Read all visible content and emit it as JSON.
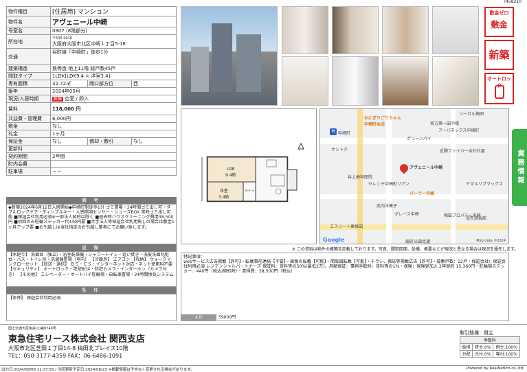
{
  "doc_id": "7458210",
  "spec": {
    "type_label": "物件種目",
    "type_value": "[住居用] マンション",
    "name_label": "物件名",
    "name_value": "アヴェニール中崎",
    "room_label": "号室名",
    "room_value": "0807 (8階部分)",
    "address_label": "所在地",
    "zip": "〒530-0016",
    "address": "大阪府大阪市北区中崎１丁目5-18",
    "transit_label": "交通",
    "transit": "谷町線「中崎町」徒歩1分",
    "structure_label": "建築構造",
    "structure": "鉄骨造 地上11階 総戸数45戸",
    "layout_label": "間取タイプ",
    "layout": "1LDK[LDK9.4 × 洋室3.4]",
    "area_label": "専有面積",
    "area": "32.72㎡",
    "direction_label": "開口部方位",
    "direction": "西",
    "built_label": "築年",
    "built": "2024年05月",
    "status_label": "現況/入居時期",
    "status_badge": "新築",
    "status": "空室 / 即入",
    "rent_label": "賃料",
    "rent": "118,000 円",
    "fee_label": "共益費・管理費",
    "fee": "6,000円",
    "deposit_label": "敷金",
    "deposit": "なし",
    "key_label": "礼金",
    "key": "1ヶ月",
    "guarantee_label": "保証金",
    "guarantee": "なし",
    "amort_label": "償却・敷引",
    "amort": "なし",
    "renew_label": "更新料",
    "renew": "",
    "period_label": "契約期間",
    "period": "2年間",
    "town_label": "町内会費",
    "town": "",
    "parking_label": "駐車場",
    "parking": "－－"
  },
  "remarks_head": "備 考",
  "remarks": "◆新築2024年6月12日入居開始◆中崎町駅徒歩1分 ゴミ置場・24時間ゴミ出し可・ダブルロックドア・ディンプルキー・人感照明センサー・シューズBOX 常時ゴミ出し可能 ■保証会社利用必須※一部法人契約は除く ■退去時ハウスクリーニング費用38,500円 ■初回のみ駐輪ステッカー代440円要 ■大手法人等保証会社利用無しの場合は敷金1ヶ月アップ要 ■お引越しは当社指定のお引越し業者にてお願い致します。",
  "facilities_head": "設 備",
  "facilities": "【水廻り】 洗面台（独立）・浴室乾燥機・シャワートイレ・追い焚き・洗髪洗面化粧台・バス・トイレ別・洗濯機置場（室内） 【冷暖房】 エアコン 【収納】 ウォークインクローゼット 【放送・通信】 ＢＳ・ＣＳ・インターネット対応・ネット使用料不要 【セキュリティ】 オートロック・宅配BOX・防犯カメラ・インターホン（カメラ付き） 【その他】 エレベーター・オートバイ駐輪場・自転車置場・24時間換気システム",
  "conditions_head": "条 件",
  "conditions": "【条件】 保証会社利用必須",
  "badges": {
    "zero": "敷金ゼロ",
    "zero_sub": "敷金",
    "new": "新築",
    "lock": "オートロック"
  },
  "side_tab": "業務情報",
  "floorplan": {
    "ldk": "LDK\n9.4帖",
    "western": "洋室\n3.4帖",
    "closet": "ｸﾛｰｾﾞｯﾄ"
  },
  "map": {
    "station": "中崎町",
    "shop1": "おにぎりごりちゃん 中崎町本店",
    "shop2": "パーラー中崎",
    "target": "アヴェニール中崎",
    "labels": [
      "リーガル梅田",
      "実方第一田中橋",
      "アーバネックス中崎町",
      "グリーンパイ",
      "近隣ファイバー本社社屋",
      "井上歯科医院",
      "セレニテ中崎町リアン",
      "ヤマルリブマックス",
      "武内洋菓子",
      "グレース中崎",
      "エスリート東梅田",
      "扇町公園北通",
      "サントク",
      "北天満会館",
      "梅田プロパティ中崎"
    ],
    "google": "Google",
    "credit": "Map data ©2024"
  },
  "disclaimer": "※ この資料は物件の概略を記載しております。写真、間取図面、設備、概要などが現況と異なる場合は現況を優先します。",
  "special": {
    "label": "特記事項：",
    "text": "webサービス広告掲載【許可】・転載事前連絡【不要】・画像の転載【可能】・間取図転載【可能】・チラシ、雑誌等掲載広告【許可】・募集戸数：22戸・保証会社：保証会社利用必須 レジデンシャルパートナーズ 保証料：賃料等の50%(最低2万)、月額保証：事務手数料：賃料等の1%・保険：保険更加入 2年契約 15,360円・駐輪場ステッカー：440円（税込/契約時）・清掃費：38,500円（税込）",
    "ad_label": "ＡＤ",
    "ad_value": "59000円"
  },
  "company": {
    "license": "国土交通大臣免許(2)第8740号",
    "name": "東急住宅リース株式会社 関西支店",
    "address": "大阪市北区芝田１丁目14-8 梅田北プレイス10階",
    "tel": "TEL：050-3177-4359 FAX：06-6486-1091"
  },
  "fees": {
    "mode_label": "取引態様：",
    "mode": "貸主",
    "fee_head": "手数料",
    "row1_label": "負担",
    "row1_a": "貸主:0%",
    "row1_b": "借主:100%",
    "row2_label": "分配",
    "row2_a": "元付:0%",
    "row2_b": "客付:100%"
  },
  "footer": {
    "printed": "出力日:2024/08/09 11:37:55 / 次回更新予定日:2024/08/23 ※掲載情報は予告なく変更される場合があります。",
    "powered": "Powered by RealNetPro.co.,ltd."
  }
}
